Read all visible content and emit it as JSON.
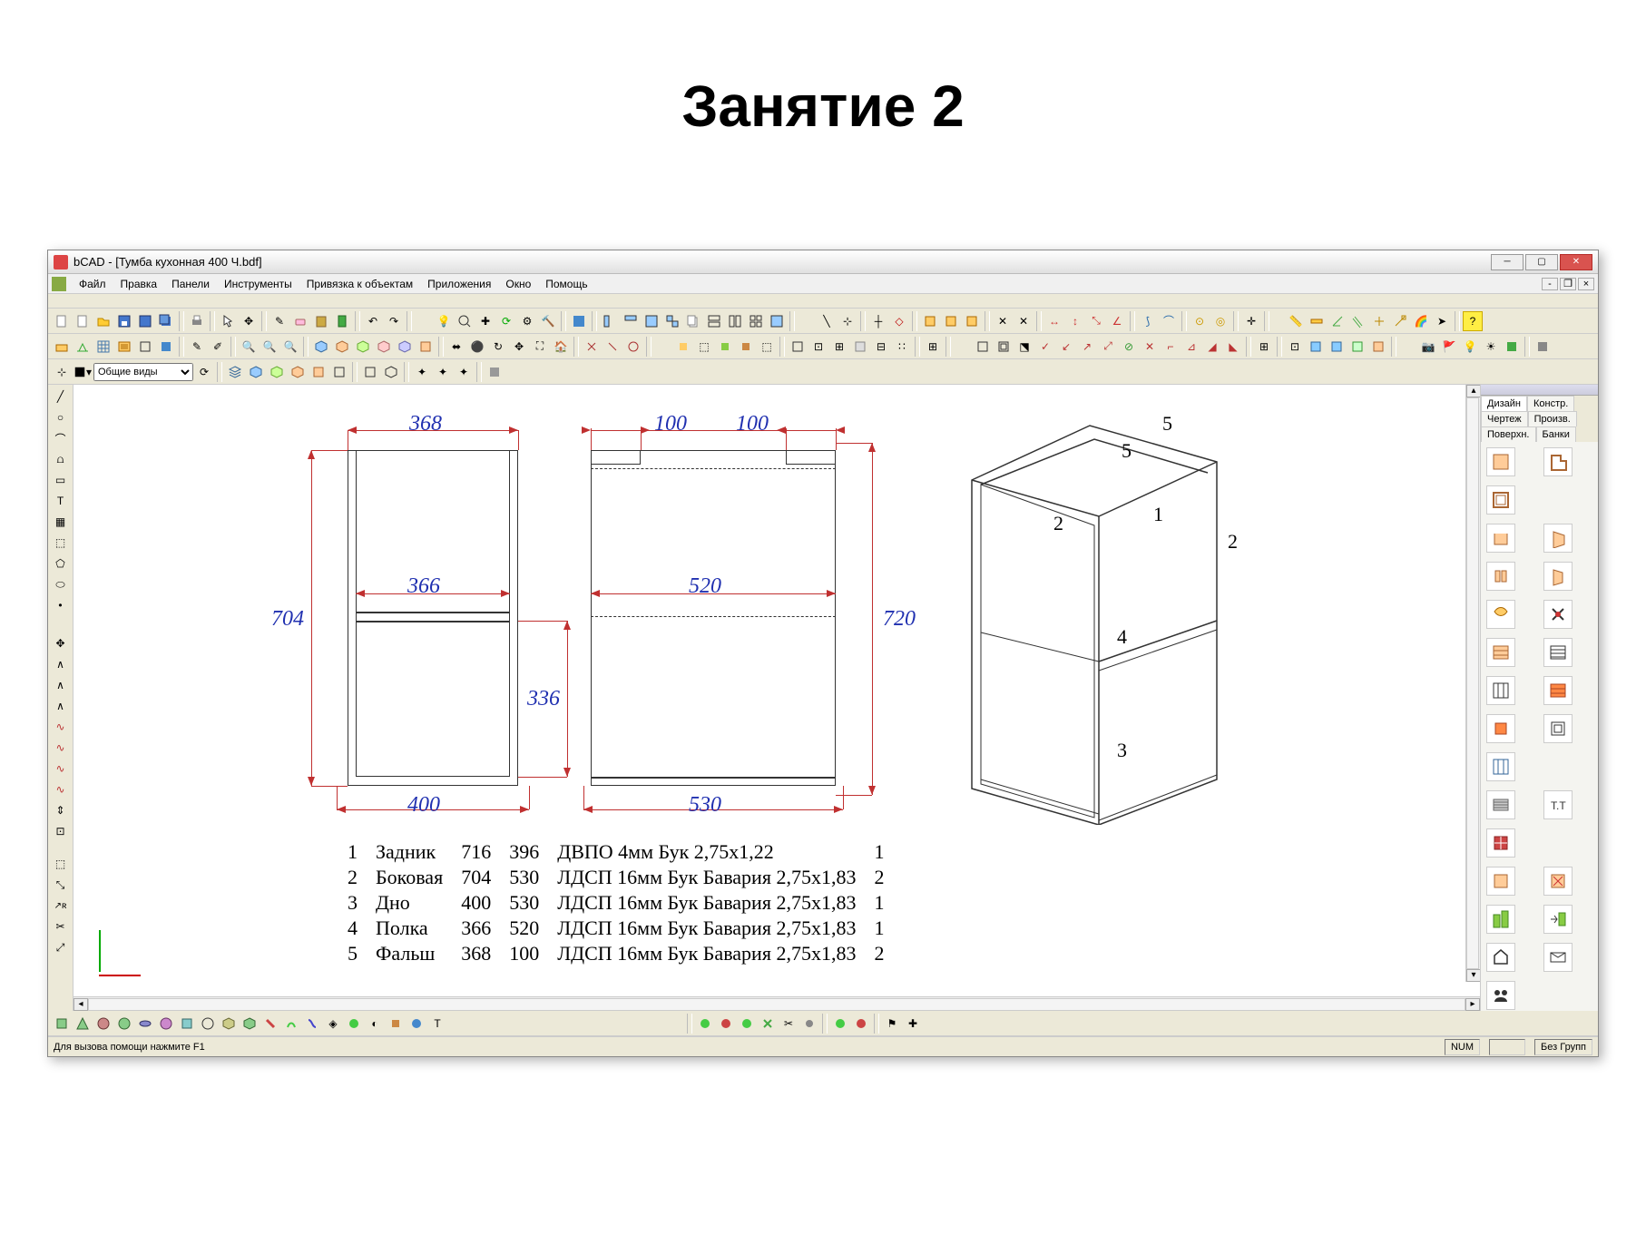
{
  "page_title": "Занятие 2",
  "app": {
    "title": "bCAD - [Тумба кухонная 400 Ч.bdf]",
    "menus": [
      "Файл",
      "Правка",
      "Панели",
      "Инструменты",
      "Привязка к объектам",
      "Приложения",
      "Окно",
      "Помощь"
    ],
    "view_selector": "Общие виды",
    "status_hint": "Для вызова помощи нажмите F1",
    "status_num": "NUM",
    "status_group": "Без Групп"
  },
  "right_panel": {
    "tabs_row1": [
      "Дизайн",
      "Констр."
    ],
    "tabs_row2": [
      "Чертеж",
      "Произв."
    ],
    "tabs_row3": [
      "Поверхн.",
      "Банки"
    ]
  },
  "dimensions": {
    "d368": "368",
    "d100a": "100",
    "d100b": "100",
    "d366": "366",
    "d520": "520",
    "d704": "704",
    "d720": "720",
    "d336": "336",
    "d400": "400",
    "d530": "530"
  },
  "iso_labels": {
    "p1": "1",
    "p2": "2",
    "p3": "3",
    "p4": "4",
    "p5": "5",
    "p2b": "2",
    "p5b": "5"
  },
  "parts": [
    {
      "n": "1",
      "name": "Задник",
      "w": "716",
      "h": "396",
      "mat": "ДВПО 4мм Бук 2,75х1,22",
      "qty": "1"
    },
    {
      "n": "2",
      "name": "Боковая",
      "w": "704",
      "h": "530",
      "mat": "ЛДСП 16мм Бук Бавария 2,75х1,83",
      "qty": "2"
    },
    {
      "n": "3",
      "name": "Дно",
      "w": "400",
      "h": "530",
      "mat": "ЛДСП 16мм Бук Бавария 2,75х1,83",
      "qty": "1"
    },
    {
      "n": "4",
      "name": "Полка",
      "w": "366",
      "h": "520",
      "mat": "ЛДСП 16мм Бук Бавария 2,75х1,83",
      "qty": "1"
    },
    {
      "n": "5",
      "name": "Фальш",
      "w": "368",
      "h": "100",
      "mat": "ЛДСП 16мм Бук Бавария 2,75х1,83",
      "qty": "2"
    }
  ]
}
